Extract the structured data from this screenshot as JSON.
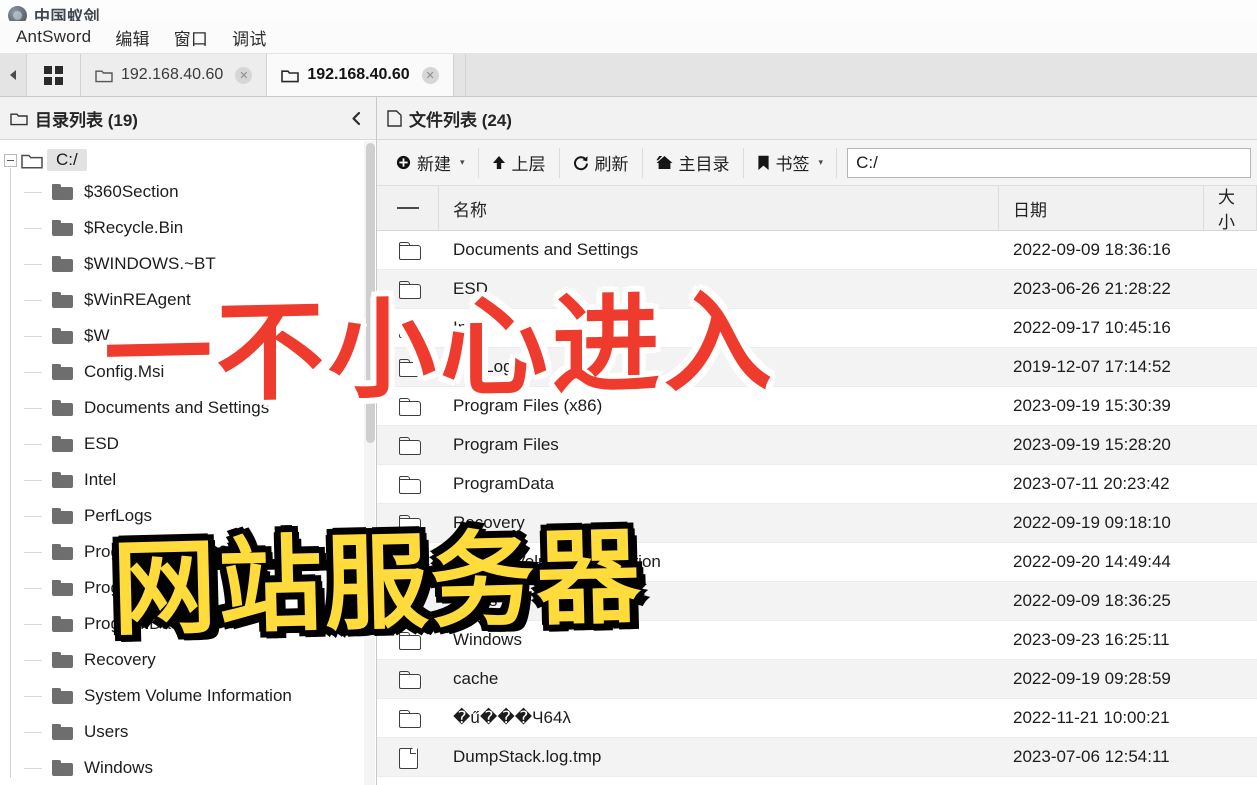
{
  "window": {
    "title": "中国蚁剑",
    "logo_icon": "antsword-logo-icon"
  },
  "menubar": {
    "items": [
      {
        "label": "AntSword"
      },
      {
        "label": "编辑"
      },
      {
        "label": "窗口"
      },
      {
        "label": "调试"
      }
    ]
  },
  "tabstrip": {
    "nav_arrow_icon": "chevron-left-icon",
    "grid_icon": "grid-view-icon",
    "tabs": [
      {
        "label": "192.168.40.60",
        "icon": "folder-icon",
        "close_icon": "close-icon",
        "active": false
      },
      {
        "label": "192.168.40.60",
        "icon": "folder-icon",
        "close_icon": "close-icon",
        "active": true
      }
    ]
  },
  "tree_panel": {
    "header": {
      "icon": "folder-icon",
      "title": "目录列表 (19)",
      "collapse_icon": "chevron-left-icon",
      "collapse_label": "‹"
    },
    "root": {
      "label": "C:/",
      "expanded": true
    },
    "items": [
      {
        "label": "$360Section"
      },
      {
        "label": "$Recycle.Bin"
      },
      {
        "label": "$WINDOWS.~BT"
      },
      {
        "label": "$WinREAgent"
      },
      {
        "label": "$W"
      },
      {
        "label": "Config.Msi"
      },
      {
        "label": "Documents and Settings"
      },
      {
        "label": "ESD"
      },
      {
        "label": "Intel"
      },
      {
        "label": "PerfLogs"
      },
      {
        "label": "Program Files (x86)"
      },
      {
        "label": "Program Files"
      },
      {
        "label": "ProgramData"
      },
      {
        "label": "Recovery"
      },
      {
        "label": "System Volume Information"
      },
      {
        "label": "Users"
      },
      {
        "label": "Windows"
      }
    ]
  },
  "file_panel": {
    "header": {
      "icon": "file-icon",
      "title": "文件列表 (24)"
    },
    "toolbar": {
      "new_label": "新建",
      "new_icon": "plus-circle-icon",
      "new_caret": "▾",
      "up_label": "上层",
      "up_icon": "arrow-up-icon",
      "refresh_label": "刷新",
      "refresh_icon": "refresh-icon",
      "home_label": "主目录",
      "home_icon": "home-icon",
      "bookmark_label": "书签",
      "bookmark_icon": "bookmark-icon",
      "bookmark_caret": "▾",
      "path_value": "C:/",
      "path_placeholder": "C:/"
    },
    "columns": {
      "check": "",
      "name": "名称",
      "date": "日期",
      "size": "大小"
    },
    "rows": [
      {
        "icon": "folder-icon",
        "name": "Documents and Settings",
        "date": "2022-09-09 18:36:16",
        "size": ""
      },
      {
        "icon": "folder-icon",
        "name": "ESD",
        "date": "2023-06-26 21:28:22",
        "size": ""
      },
      {
        "icon": "folder-icon",
        "name": "Intel",
        "date": "2022-09-17 10:45:16",
        "size": ""
      },
      {
        "icon": "folder-icon",
        "name": "PerfLogs",
        "date": "2019-12-07 17:14:52",
        "size": ""
      },
      {
        "icon": "folder-icon",
        "name": "Program Files (x86)",
        "date": "2023-09-19 15:30:39",
        "size": ""
      },
      {
        "icon": "folder-icon",
        "name": "Program Files",
        "date": "2023-09-19 15:28:20",
        "size": ""
      },
      {
        "icon": "folder-icon",
        "name": "ProgramData",
        "date": "2023-07-11 20:23:42",
        "size": ""
      },
      {
        "icon": "folder-icon",
        "name": "Recovery",
        "date": "2022-09-19 09:18:10",
        "size": ""
      },
      {
        "icon": "folder-icon",
        "name": "System Volume Information",
        "date": "2022-09-20 14:49:44",
        "size": ""
      },
      {
        "icon": "folder-icon",
        "name": "Users",
        "date": "2022-09-09 18:36:25",
        "size": ""
      },
      {
        "icon": "folder-icon",
        "name": "Windows",
        "date": "2023-09-23 16:25:11",
        "size": ""
      },
      {
        "icon": "folder-icon",
        "name": "cache",
        "date": "2022-09-19 09:28:59",
        "size": ""
      },
      {
        "icon": "folder-icon",
        "name": "�ű���Ч64λ",
        "date": "2022-11-21 10:00:21",
        "size": ""
      },
      {
        "icon": "file-icon",
        "name": "DumpStack.log.tmp",
        "date": "2023-07-06 12:54:11",
        "size": ""
      }
    ]
  },
  "overlays": {
    "red_caption": "一不小心进入",
    "yellow_caption": "网站服务器",
    "red_color": "#ef3b2d",
    "yellow_color": "#ffdc3c"
  }
}
